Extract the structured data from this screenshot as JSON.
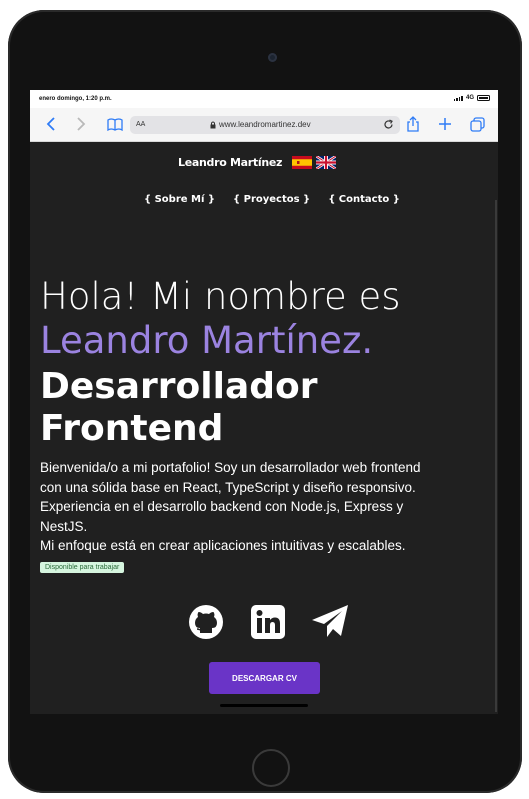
{
  "status_bar": {
    "time": "enero domingo, 1:20 p.m.",
    "network": "4G"
  },
  "browser": {
    "aa_label": "AA",
    "url": "www.leandromartinez.dev"
  },
  "header": {
    "name": "Leandro Martínez"
  },
  "nav": {
    "items": [
      "{ Sobre Mí }",
      "{ Proyectos }",
      "{ Contacto }"
    ]
  },
  "hero": {
    "greeting": "Hola! Mi nombre es",
    "name": "Leandro Martínez.",
    "role_line1": "Desarrollador",
    "role_line2": "Frontend",
    "bio_lines": [
      "Bienvenida/o a mi portafolio! Soy un desarrollador web frontend",
      "con una sólida base en React, TypeScript y diseño responsivo.",
      "Experiencia en el desarrollo backend con Node.js, Express y",
      "NestJS.",
      "Mi enfoque está en crear aplicaciones intuitivas y escalables."
    ],
    "availability_badge": "Disponible para trabajar",
    "cv_button": "DESCARGAR CV"
  },
  "icons": [
    "github-icon",
    "linkedin-icon",
    "telegram-icon",
    "spain-flag-icon",
    "uk-flag-icon"
  ],
  "colors": {
    "accent": "#9b83e0",
    "button": "#6a34c7",
    "page_bg": "#202020",
    "badge_bg": "#d6f5df"
  }
}
